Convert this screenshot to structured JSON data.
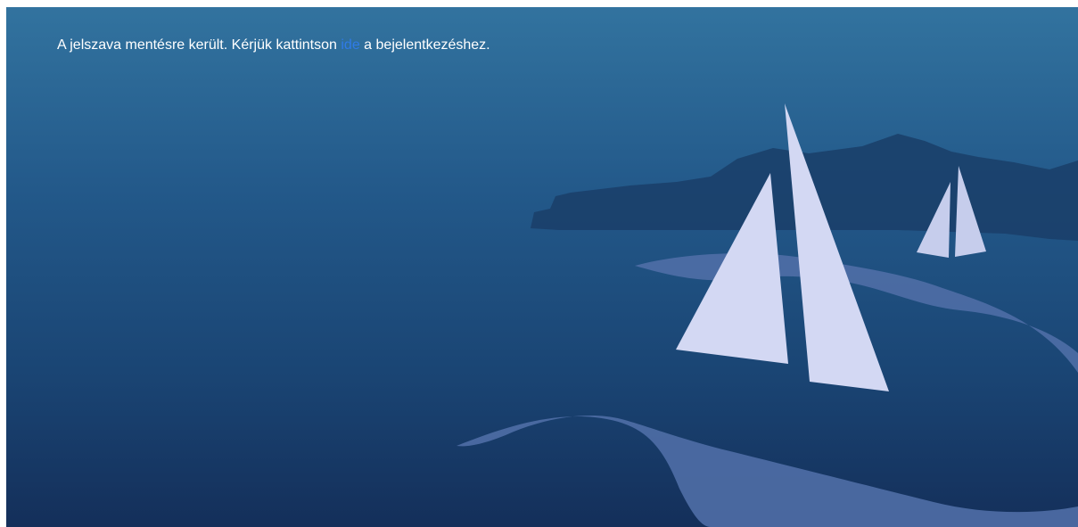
{
  "message": {
    "before_link": "A jelszava mentésre került. Kérjük kattintson ",
    "link_label": "ide",
    "after_link": " a bejelentkezéshez."
  },
  "colors": {
    "background_top": "#32739f",
    "background_bottom": "#142f5a",
    "link": "#2f7be8",
    "sail": "#d3d8f3",
    "wave": "#4f6ea6",
    "mountains": "#1a3e68"
  }
}
